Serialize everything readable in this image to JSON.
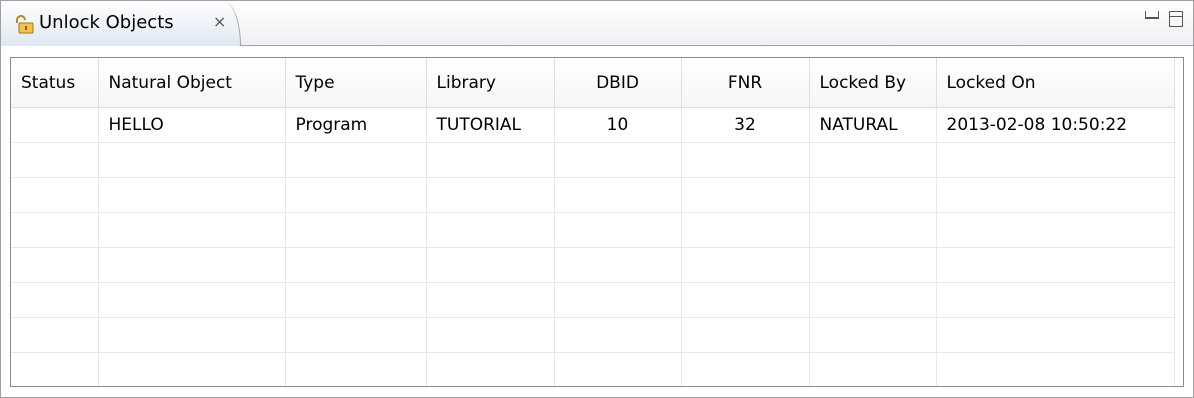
{
  "view": {
    "tab_title": "Unlock Objects",
    "tab_close_glyph": "⨯",
    "icons": {
      "tab": "unlock-icon",
      "minimize": "minimize-icon",
      "maximize": "maximize-icon"
    }
  },
  "table": {
    "columns": [
      "Status",
      "Natural Object",
      "Type",
      "Library",
      "DBID",
      "FNR",
      "Locked By",
      "Locked On"
    ],
    "rows": [
      [
        "",
        "HELLO",
        "Program",
        "TUTORIAL",
        "10",
        "32",
        "NATURAL",
        "2013-02-08 10:50:22"
      ],
      [
        "",
        "",
        "",
        "",
        "",
        "",
        "",
        ""
      ],
      [
        "",
        "",
        "",
        "",
        "",
        "",
        "",
        ""
      ],
      [
        "",
        "",
        "",
        "",
        "",
        "",
        "",
        ""
      ],
      [
        "",
        "",
        "",
        "",
        "",
        "",
        "",
        ""
      ],
      [
        "",
        "",
        "",
        "",
        "",
        "",
        "",
        ""
      ],
      [
        "",
        "",
        "",
        "",
        "",
        "",
        "",
        ""
      ],
      [
        "",
        "",
        "",
        "",
        "",
        "",
        "",
        ""
      ]
    ]
  }
}
